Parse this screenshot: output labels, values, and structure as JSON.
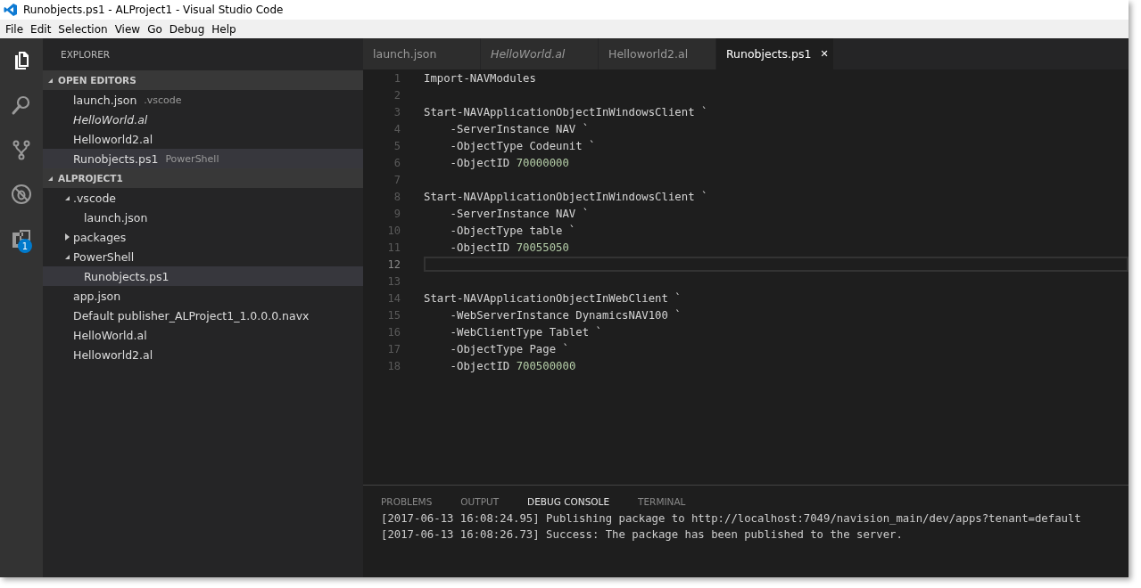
{
  "window": {
    "title": "Runobjects.ps1 - ALProject1 - Visual Studio Code"
  },
  "menu": [
    "File",
    "Edit",
    "Selection",
    "View",
    "Go",
    "Debug",
    "Help"
  ],
  "activity_bar": [
    {
      "kind": "files",
      "selected": true
    },
    {
      "kind": "search",
      "selected": false
    },
    {
      "kind": "source-control",
      "selected": false
    },
    {
      "kind": "debug",
      "selected": false
    },
    {
      "kind": "extensions",
      "selected": false,
      "badge": "1"
    }
  ],
  "sidebar": {
    "title": "EXPLORER",
    "open_editors": {
      "label": "OPEN EDITORS",
      "expanded": true,
      "items": [
        {
          "name": "launch.json",
          "description": ".vscode",
          "italic": false,
          "selected": false
        },
        {
          "name": "HelloWorld.al",
          "italic": true,
          "selected": false
        },
        {
          "name": "Helloworld2.al",
          "italic": false,
          "selected": false
        },
        {
          "name": "Runobjects.ps1",
          "description": "PowerShell",
          "italic": false,
          "selected": true
        }
      ]
    },
    "project": {
      "label": "ALPROJECT1",
      "expanded": true,
      "items": [
        {
          "name": ".vscode",
          "kind": "folder",
          "expanded": true,
          "selected": false,
          "children": [
            {
              "name": "launch.json",
              "kind": "file",
              "selected": false
            }
          ]
        },
        {
          "name": "packages",
          "kind": "folder",
          "expanded": false,
          "selected": false
        },
        {
          "name": "PowerShell",
          "kind": "folder",
          "expanded": true,
          "selected": false,
          "children": [
            {
              "name": "Runobjects.ps1",
              "kind": "file",
              "selected": true
            }
          ]
        },
        {
          "name": "app.json",
          "kind": "file",
          "selected": false
        },
        {
          "name": "Default publisher_ALProject1_1.0.0.0.navx",
          "kind": "file",
          "selected": false
        },
        {
          "name": "HelloWorld.al",
          "kind": "file",
          "selected": false
        },
        {
          "name": "Helloworld2.al",
          "kind": "file",
          "selected": false
        }
      ]
    }
  },
  "tabs": [
    {
      "label": "launch.json",
      "italic": false,
      "selected": false
    },
    {
      "label": "HelloWorld.al",
      "italic": true,
      "selected": false
    },
    {
      "label": "Helloworld2.al",
      "italic": false,
      "selected": false
    },
    {
      "label": "Runobjects.ps1",
      "italic": false,
      "selected": true,
      "close": "✕"
    }
  ],
  "code": [
    {
      "number": "1",
      "current": false,
      "tokens": [
        {
          "text": "Import-NAVModules",
          "kind": "plain"
        }
      ]
    },
    {
      "number": "2",
      "current": false
    },
    {
      "number": "3",
      "current": false,
      "tokens": [
        {
          "text": "Start-NAVApplicationObjectInWindowsClient `",
          "kind": "plain"
        }
      ]
    },
    {
      "number": "4",
      "current": false,
      "tokens": [
        {
          "text": "    -ServerInstance NAV `",
          "kind": "plain"
        }
      ]
    },
    {
      "number": "5",
      "current": false,
      "tokens": [
        {
          "text": "    -ObjectType Codeunit `",
          "kind": "plain"
        }
      ]
    },
    {
      "number": "6",
      "current": false,
      "tokens": [
        {
          "text": "    -ObjectID ",
          "kind": "plain"
        },
        {
          "text": "70000000",
          "kind": "number"
        }
      ]
    },
    {
      "number": "7",
      "current": false
    },
    {
      "number": "8",
      "current": false,
      "tokens": [
        {
          "text": "Start-NAVApplicationObjectInWindowsClient `",
          "kind": "plain"
        }
      ]
    },
    {
      "number": "9",
      "current": false,
      "tokens": [
        {
          "text": "    -ServerInstance NAV `",
          "kind": "plain"
        }
      ]
    },
    {
      "number": "10",
      "current": false,
      "tokens": [
        {
          "text": "    -ObjectType table `",
          "kind": "plain"
        }
      ]
    },
    {
      "number": "11",
      "current": false,
      "tokens": [
        {
          "text": "    -ObjectID ",
          "kind": "plain"
        },
        {
          "text": "70055050",
          "kind": "number"
        }
      ]
    },
    {
      "number": "12",
      "current": true
    },
    {
      "number": "13",
      "current": false
    },
    {
      "number": "14",
      "current": false,
      "tokens": [
        {
          "text": "Start-NAVApplicationObjectInWebClient `",
          "kind": "plain"
        }
      ]
    },
    {
      "number": "15",
      "current": false,
      "tokens": [
        {
          "text": "    -WebServerInstance DynamicsNAV100 `",
          "kind": "plain"
        }
      ]
    },
    {
      "number": "16",
      "current": false,
      "tokens": [
        {
          "text": "    -WebClientType Tablet `",
          "kind": "plain"
        }
      ]
    },
    {
      "number": "17",
      "current": false,
      "tokens": [
        {
          "text": "    -ObjectType Page `",
          "kind": "plain"
        }
      ]
    },
    {
      "number": "18",
      "current": false,
      "tokens": [
        {
          "text": "    -ObjectID ",
          "kind": "plain"
        },
        {
          "text": "700500000",
          "kind": "number"
        }
      ]
    }
  ],
  "panel": {
    "tabs": [
      {
        "label": "PROBLEMS",
        "selected": false
      },
      {
        "label": "OUTPUT",
        "selected": false
      },
      {
        "label": "DEBUG CONSOLE",
        "selected": true
      },
      {
        "label": "TERMINAL",
        "selected": false
      }
    ],
    "lines": [
      "[2017-06-13 16:08:24.95] Publishing package to http://localhost:7049/navision_main/dev/apps?tenant=default",
      "[2017-06-13 16:08:26.73] Success: The package has been published to the server."
    ]
  }
}
